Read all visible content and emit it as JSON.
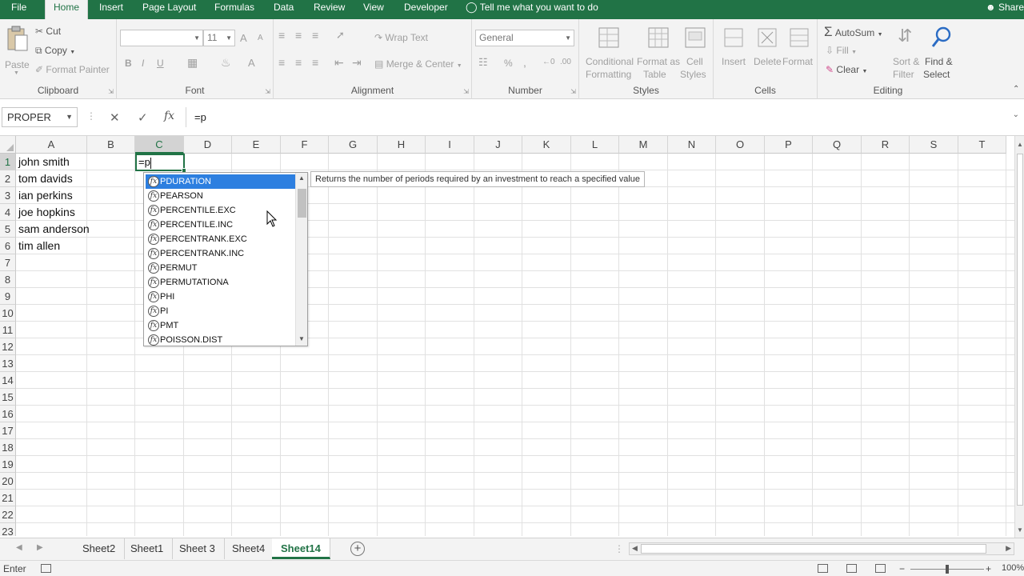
{
  "ribbon_tabs": [
    {
      "label": "File",
      "active": false
    },
    {
      "label": "Home",
      "active": true
    },
    {
      "label": "Insert",
      "active": false
    },
    {
      "label": "Page Layout",
      "active": false
    },
    {
      "label": "Formulas",
      "active": false
    },
    {
      "label": "Data",
      "active": false
    },
    {
      "label": "Review",
      "active": false
    },
    {
      "label": "View",
      "active": false
    },
    {
      "label": "Developer",
      "active": false
    }
  ],
  "tell_me": "Tell me what you want to do",
  "share": "Share",
  "clipboard": {
    "paste": "Paste",
    "cut": "Cut",
    "copy": "Copy",
    "format_painter": "Format Painter",
    "label": "Clipboard"
  },
  "font": {
    "size": "11",
    "bold": "B",
    "italic": "I",
    "underline": "U",
    "grow": "A",
    "shrink": "A",
    "color": "A",
    "label": "Font"
  },
  "alignment": {
    "wrap": "Wrap Text",
    "merge": "Merge & Center",
    "label": "Alignment"
  },
  "number": {
    "format": "General",
    "percent": "%",
    "comma": ",",
    "label": "Number"
  },
  "styles": {
    "conditional_1": "Conditional",
    "conditional_2": "Formatting",
    "format_table_1": "Format as",
    "format_table_2": "Table",
    "cell_styles_1": "Cell",
    "cell_styles_2": "Styles",
    "label": "Styles"
  },
  "cells": {
    "insert": "Insert",
    "delete": "Delete",
    "format": "Format",
    "label": "Cells"
  },
  "editing": {
    "autosum": "AutoSum",
    "fill": "Fill",
    "clear": "Clear",
    "sort_1": "Sort &",
    "sort_2": "Filter",
    "find_1": "Find &",
    "find_2": "Select",
    "label": "Editing"
  },
  "formula_bar": {
    "name_box": "PROPER",
    "cancel": "✕",
    "enter": "✓",
    "fx": "fx",
    "content": "=p"
  },
  "columns": [
    "A",
    "B",
    "C",
    "D",
    "E",
    "F",
    "G",
    "H",
    "I",
    "J",
    "K",
    "L",
    "M",
    "N",
    "O",
    "P",
    "Q",
    "R",
    "S",
    "T"
  ],
  "rows": [
    "1",
    "2",
    "3",
    "4",
    "5",
    "6",
    "7",
    "8",
    "9",
    "10",
    "11",
    "12",
    "13",
    "14",
    "15",
    "16",
    "17",
    "18",
    "19",
    "20",
    "21",
    "22",
    "23"
  ],
  "selected_column": "C",
  "selected_row": "1",
  "cells_data": [
    {
      "text": "john smith"
    },
    {
      "text": "tom davids"
    },
    {
      "text": "ian perkins"
    },
    {
      "text": "joe hopkins"
    },
    {
      "text": "sam anderson"
    },
    {
      "text": "tim allen"
    }
  ],
  "active_cell_text": "=p",
  "autocomplete": [
    "PDURATION",
    "PEARSON",
    "PERCENTILE.EXC",
    "PERCENTILE.INC",
    "PERCENTRANK.EXC",
    "PERCENTRANK.INC",
    "PERMUT",
    "PERMUTATIONA",
    "PHI",
    "PI",
    "PMT",
    "POISSON.DIST"
  ],
  "autocomplete_selected": 0,
  "tooltip": "Returns the number of periods required by an investment to reach a specified value",
  "sheets": [
    {
      "label": "Sheet2",
      "active": false
    },
    {
      "label": "Sheet1",
      "active": false
    },
    {
      "label": "Sheet 3",
      "active": false
    },
    {
      "label": "Sheet4",
      "active": false
    },
    {
      "label": "Sheet14",
      "active": true
    }
  ],
  "status": {
    "mode": "Enter",
    "zoom": "100%"
  },
  "accent_color": "#217346",
  "highlight_color": "#2d7fe0"
}
